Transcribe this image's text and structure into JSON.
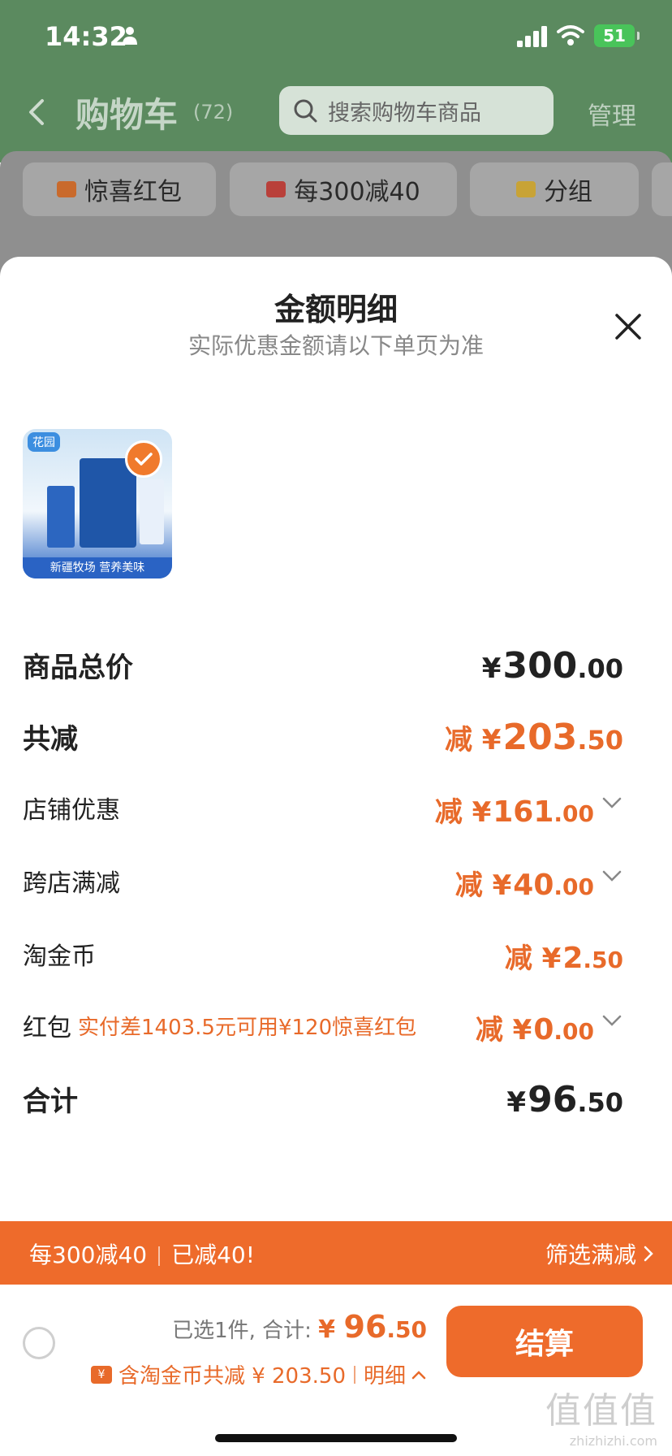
{
  "status_bar": {
    "time": "14:32",
    "battery": "51"
  },
  "header": {
    "title": "购物车",
    "count": "(72)",
    "search_placeholder": "搜索购物车商品",
    "manage": "管理"
  },
  "chips": [
    {
      "label": "惊喜红包",
      "icon": "red-envelope-icon"
    },
    {
      "label": "每300减40",
      "icon": "shop-icon"
    },
    {
      "label": "分组",
      "icon": "folder-icon"
    }
  ],
  "sheet": {
    "title": "金额明细",
    "subtitle": "实际优惠金额请以下单页为准"
  },
  "product": {
    "tag": "花园",
    "caption": "新疆牧场 营养美味"
  },
  "rows": {
    "total_price": {
      "label": "商品总价",
      "prefix": "¥",
      "int": "300",
      "dec": ".00"
    },
    "total_discount": {
      "label": "共减",
      "prefix": "减 ¥",
      "int": "203",
      "dec": ".50"
    },
    "store_discount": {
      "label": "店铺优惠",
      "prefix": "减 ¥",
      "int": "161",
      "dec": ".00"
    },
    "cross_store": {
      "label": "跨店满减",
      "prefix": "减 ¥",
      "int": "40",
      "dec": ".00"
    },
    "taojin_coin": {
      "label": "淘金币",
      "prefix": "减 ¥",
      "int": "2",
      "dec": ".50"
    },
    "red_packet": {
      "label": "红包",
      "note": "实付差1403.5元可用¥120惊喜红包",
      "prefix": "减 ¥",
      "int": "0",
      "dec": ".00"
    },
    "grand_total": {
      "label": "合计",
      "prefix": "¥",
      "int": "96",
      "dec": ".50"
    }
  },
  "promo": {
    "left_a": "每300减40",
    "left_b": "已减40!",
    "right": "筛选满减"
  },
  "checkout": {
    "selected_text": "已选1件, 合计:",
    "total_prefix": "¥ ",
    "total_int": "96",
    "total_dec": ".50",
    "coin_text": "含淘金币共减 ¥ 203.50",
    "detail": "明细",
    "button": "结算"
  },
  "watermark": {
    "main": "值值值",
    "sub": "zhizhizhi.com"
  },
  "colors": {
    "accent": "#ee6b2b",
    "header_green": "#5b8a5f",
    "text": "#222222",
    "muted": "#888888"
  }
}
